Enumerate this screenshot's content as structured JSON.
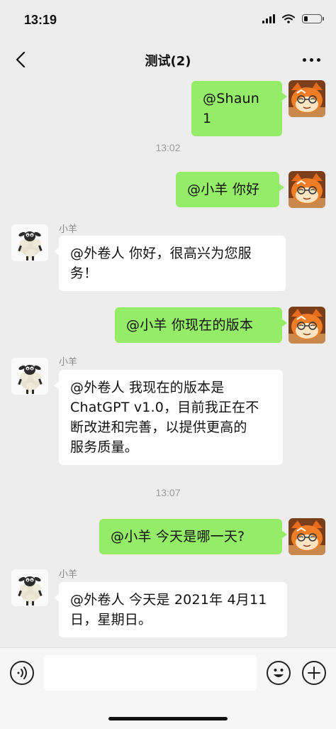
{
  "status": {
    "time": "13:19",
    "battery_level": 0.25
  },
  "nav": {
    "title": "测试(2)"
  },
  "messages": {
    "m1": {
      "text": "@Shaun 1"
    },
    "t1": "13:02",
    "m2": {
      "text": "@小羊 你好"
    },
    "m3": {
      "sender": "小羊",
      "lines": [
        "@外卷人 你好，很高兴为您服",
        "务！"
      ]
    },
    "m4": {
      "text": "@小羊 你现在的版本"
    },
    "m5": {
      "sender": "小羊",
      "lines": [
        "@外卷人 我现在的版本是",
        "ChatGPT v1.0，目前我正在不",
        "断改进和完善，以提供更高的",
        "服务质量。"
      ]
    },
    "t2": "13:07",
    "m6": {
      "text": "@小羊 今天是哪一天?"
    },
    "m7": {
      "sender": "小羊",
      "lines": [
        "@外卷人 今天是 2021年 4月11",
        "日，星期日。"
      ]
    }
  },
  "input": {
    "value": ""
  },
  "icons": {
    "voice": "voice-icon",
    "emoji": "emoji-icon",
    "plus": "plus-icon",
    "back": "back-chevron-icon",
    "more": "more-icon"
  }
}
